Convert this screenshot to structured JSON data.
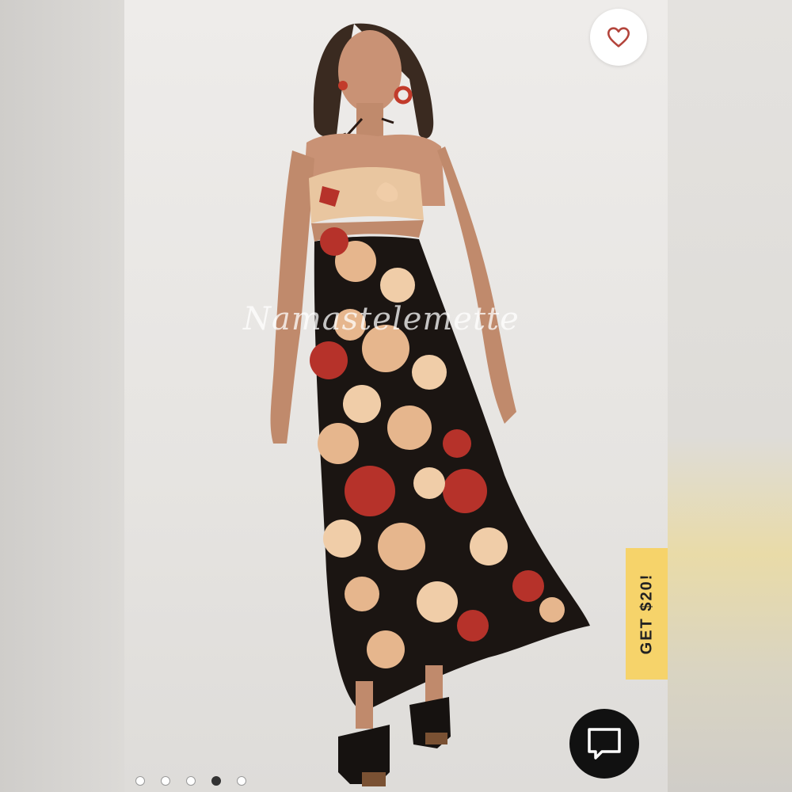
{
  "watermark": {
    "text": "Namastelemette"
  },
  "favorite": {
    "icon": "heart-outline-icon",
    "color": "#b3443b"
  },
  "promo": {
    "label": "GET $20!",
    "color": "#f6d36a"
  },
  "chat": {
    "icon": "chat-bubble-icon"
  },
  "carousel": {
    "total": 5,
    "active_index": 3
  }
}
